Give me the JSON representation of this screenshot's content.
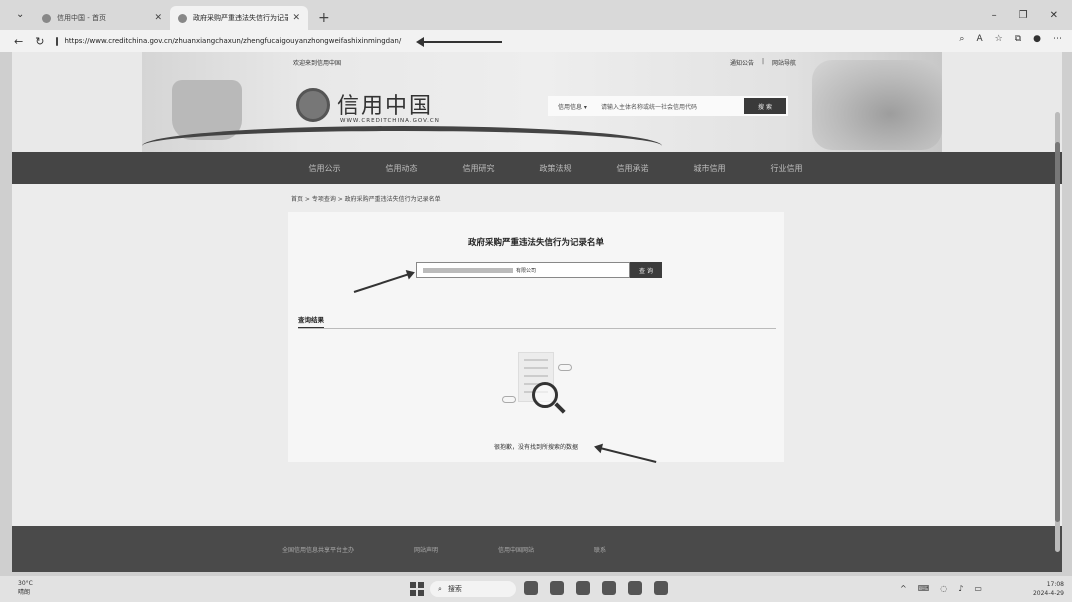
{
  "browser": {
    "tabs": [
      {
        "title": "信用中国 - 首页",
        "active": false
      },
      {
        "title": "政府采购严重违法失信行为记录名",
        "active": true
      }
    ],
    "url": "https://www.creditchina.gov.cn/zhuanxiangchaxun/zhengfucaigouyanzhongweifashixinmingdan/"
  },
  "site": {
    "welcome": "欢迎来到信用中国",
    "toplinks": [
      "通知公告",
      "网站导航"
    ],
    "logo_cn": "信用中国",
    "logo_en": "WWW.CREDITCHINA.GOV.CN",
    "search_type": "信用信息",
    "search_placeholder": "请输入主体名称或统一社会信用代码",
    "search_button": "搜 索"
  },
  "nav": {
    "items": [
      "信用公示",
      "信用动态",
      "信用研究",
      "政策法规",
      "信用承诺",
      "城市信用",
      "行业信用"
    ]
  },
  "breadcrumb": "首页 > 专项查询 > 政府采购严重违法失信行为记录名单",
  "card": {
    "title": "政府采购严重违法失信行为记录名单",
    "query_suffix": "有限公司",
    "query_button": "查 询",
    "result_tab": "查询结果",
    "empty_text": "很抱歉，没有找到所搜索的数据"
  },
  "footer": {
    "links": [
      "全国信用信息共享平台主办",
      "网站声明",
      "信用中国网站",
      "联系"
    ]
  },
  "taskbar": {
    "temp": "30°C",
    "weather": "晴朗",
    "search": "搜索",
    "time": "17:08",
    "date": "2024-4-29"
  }
}
